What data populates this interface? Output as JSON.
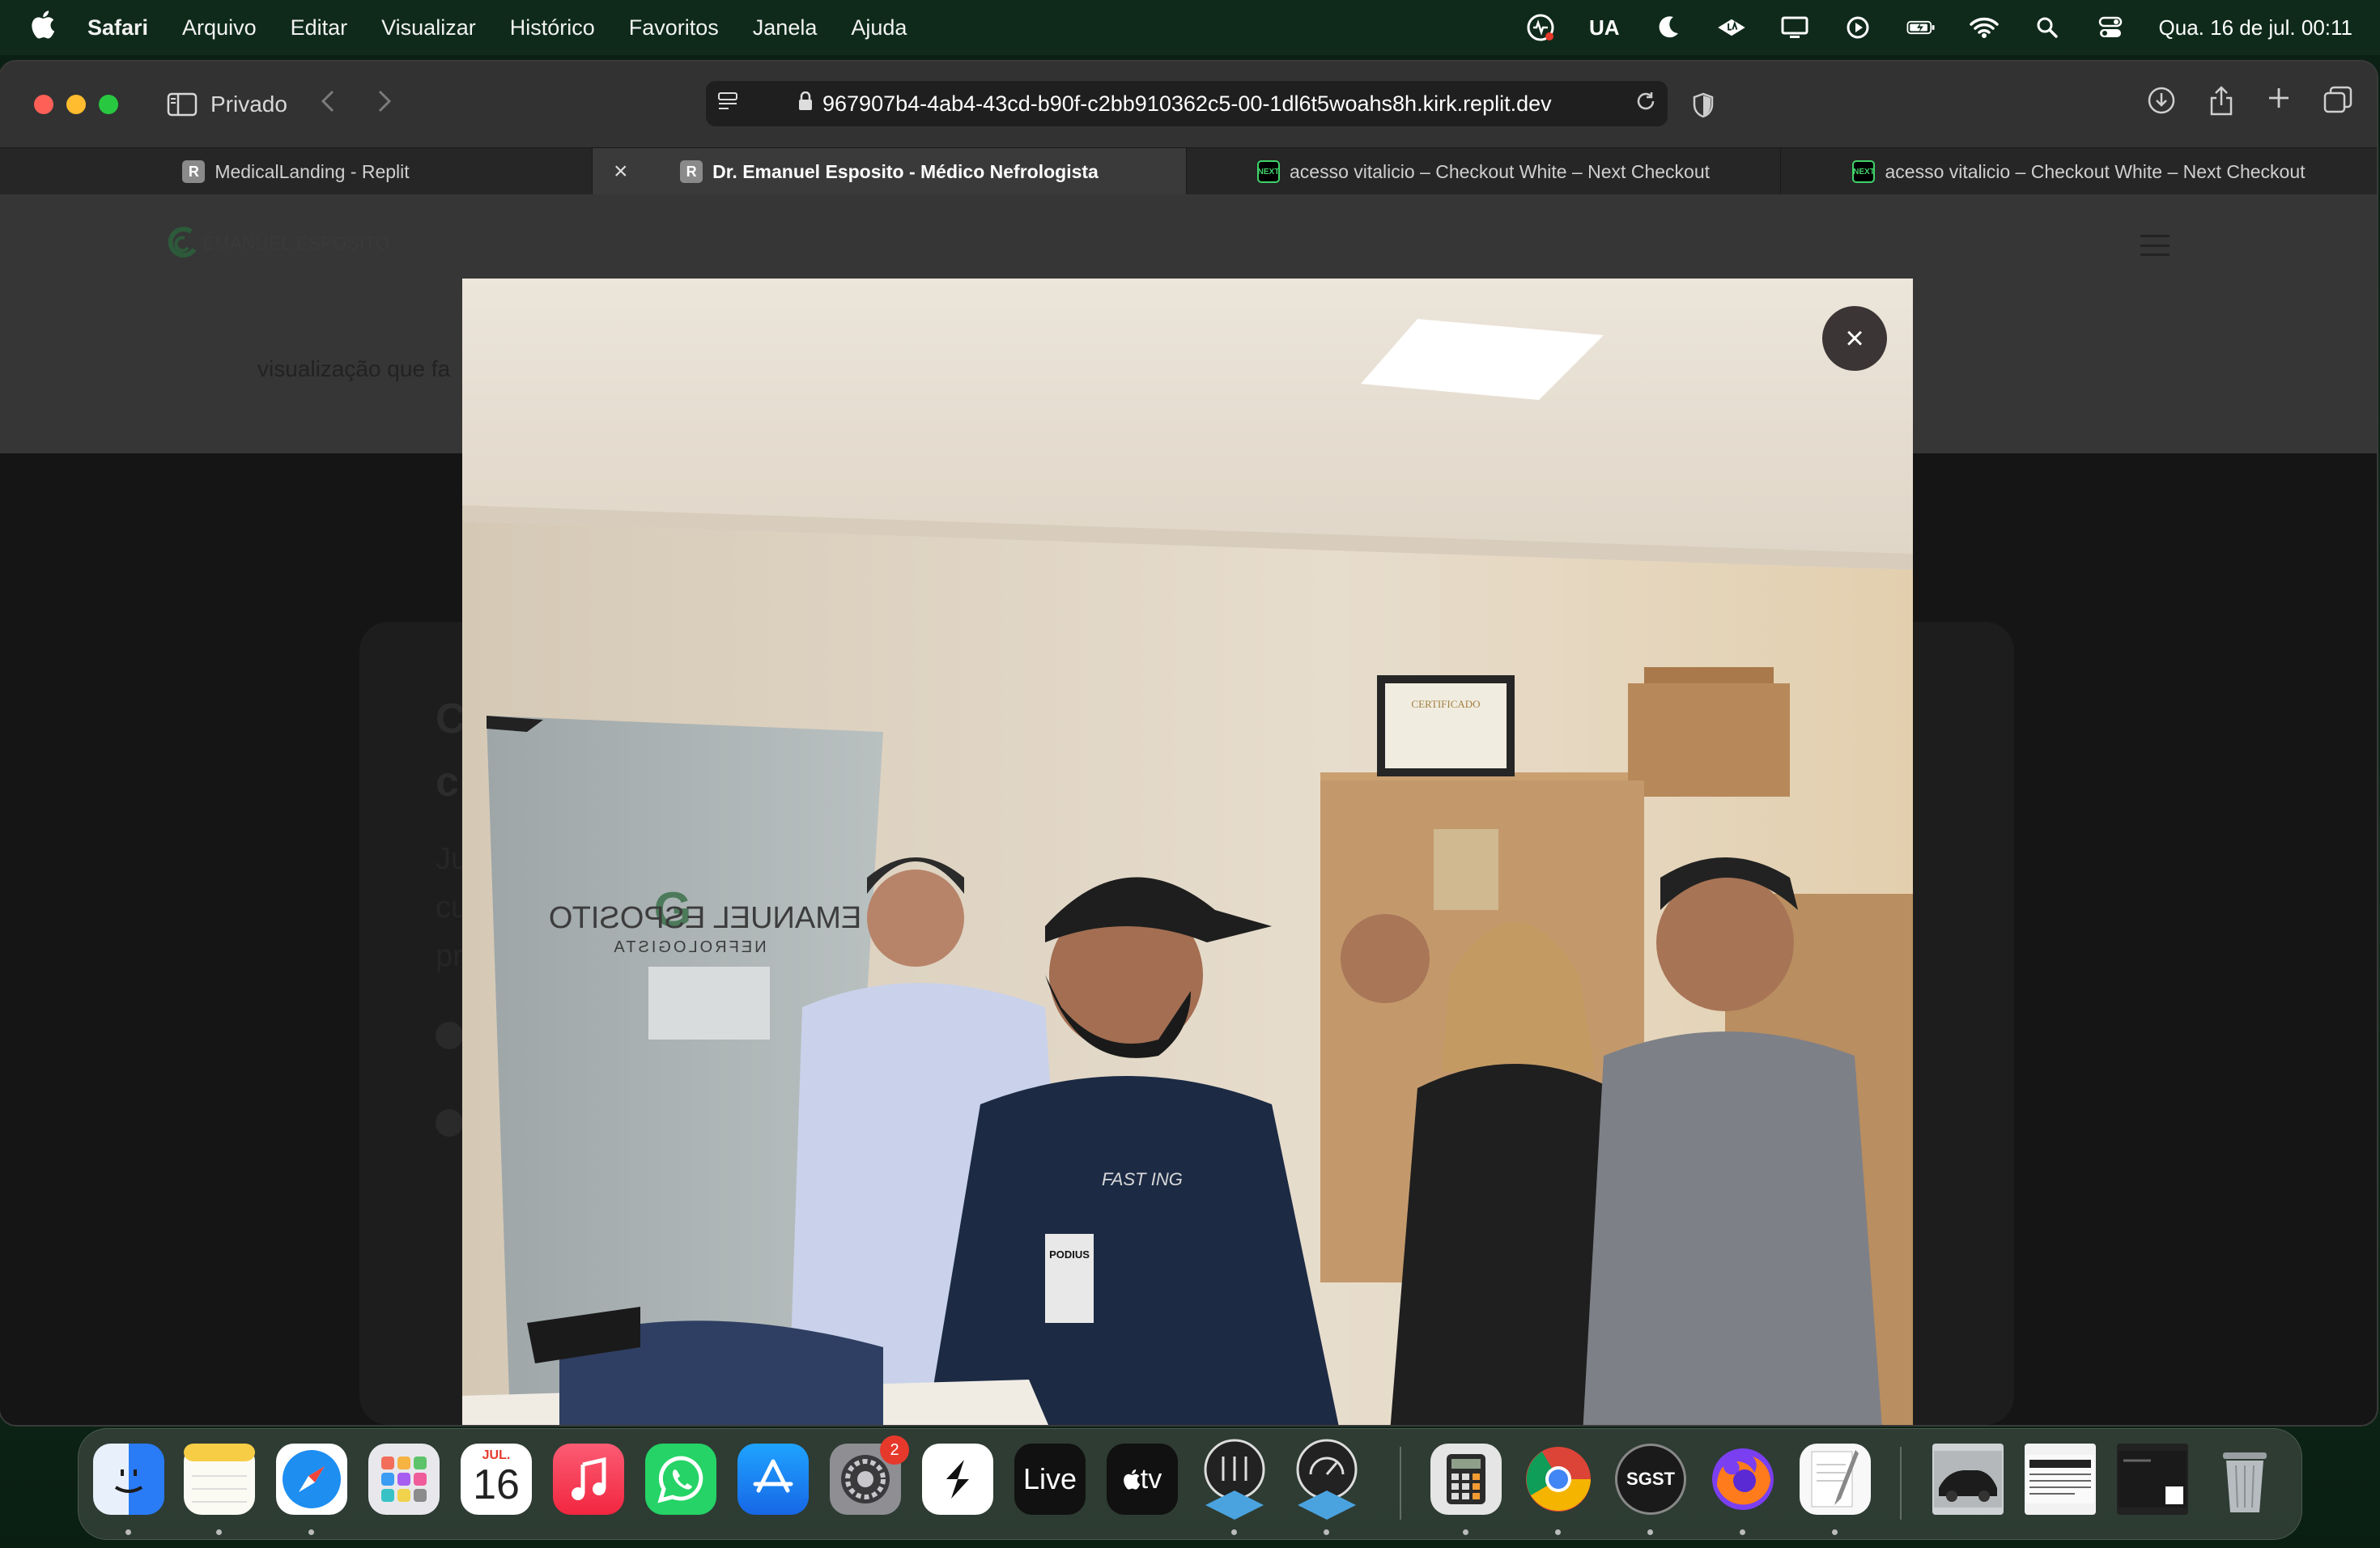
{
  "menubar": {
    "app_name": "Safari",
    "items": [
      "Arquivo",
      "Editar",
      "Visualizar",
      "Histórico",
      "Favoritos",
      "Janela",
      "Ajuda"
    ],
    "status": {
      "input_source": "UA",
      "clock": "Qua. 16 de jul.  00:11"
    }
  },
  "browser": {
    "sidebar_label": "Privado",
    "url": "967907b4-4ab4-43cd-b90f-c2bb910362c5-00-1dl6t5woahs8h.kirk.replit.dev",
    "tabs": [
      {
        "label": "MedicalLanding - Replit",
        "favicon": "R",
        "active": false
      },
      {
        "label": "Dr. Emanuel Esposito - Médico Nefrologista",
        "favicon": "R",
        "active": true
      },
      {
        "label": "acesso vitalicio – Checkout White – Next Checkout",
        "favicon": "NEXT",
        "active": false
      },
      {
        "label": "acesso vitalicio – Checkout White – Next Checkout",
        "favicon": "NEXT",
        "active": false
      }
    ]
  },
  "page": {
    "logo_text": "EMANUEL ESPOSITO",
    "behind_text": "visualização que fa",
    "bg_letters": [
      "C",
      "c",
      "Ju",
      "cu",
      "pr",
      "o"
    ],
    "modal": {
      "close_label": "×",
      "photo": {
        "door_sign_name": "EMANUEL ESPOSITO",
        "door_sign_sub": "NEFROLOGISTA",
        "certificate_title": "CERTIFICADO",
        "shirt_text": "FAST ING",
        "badge_text": "PODIUS"
      }
    }
  },
  "dock": {
    "calendar_month": "JUL.",
    "calendar_day": "16",
    "settings_badge": "2",
    "live_label": "Live",
    "tv_label": "tv",
    "sgst_label": "SGST"
  }
}
